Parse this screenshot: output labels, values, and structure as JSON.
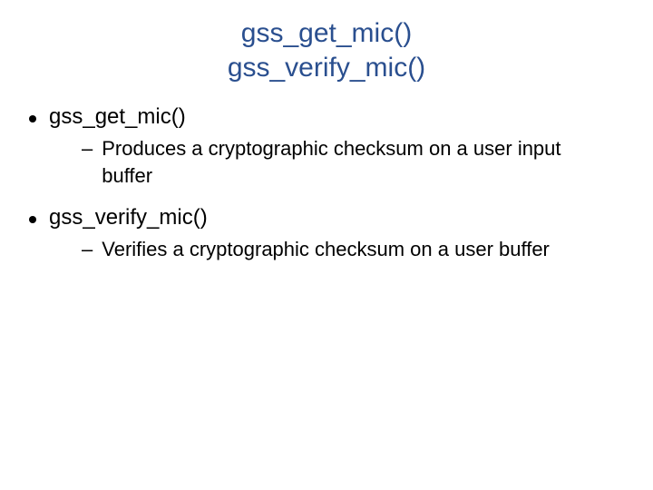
{
  "title_line1": "gss_get_mic()",
  "title_line2": "gss_verify_mic()",
  "items": [
    {
      "label": "gss_get_mic()",
      "sub": "Produces a cryptographic checksum on a user input buffer"
    },
    {
      "label": "gss_verify_mic()",
      "sub": "Verifies a cryptographic checksum on a user buffer"
    }
  ]
}
